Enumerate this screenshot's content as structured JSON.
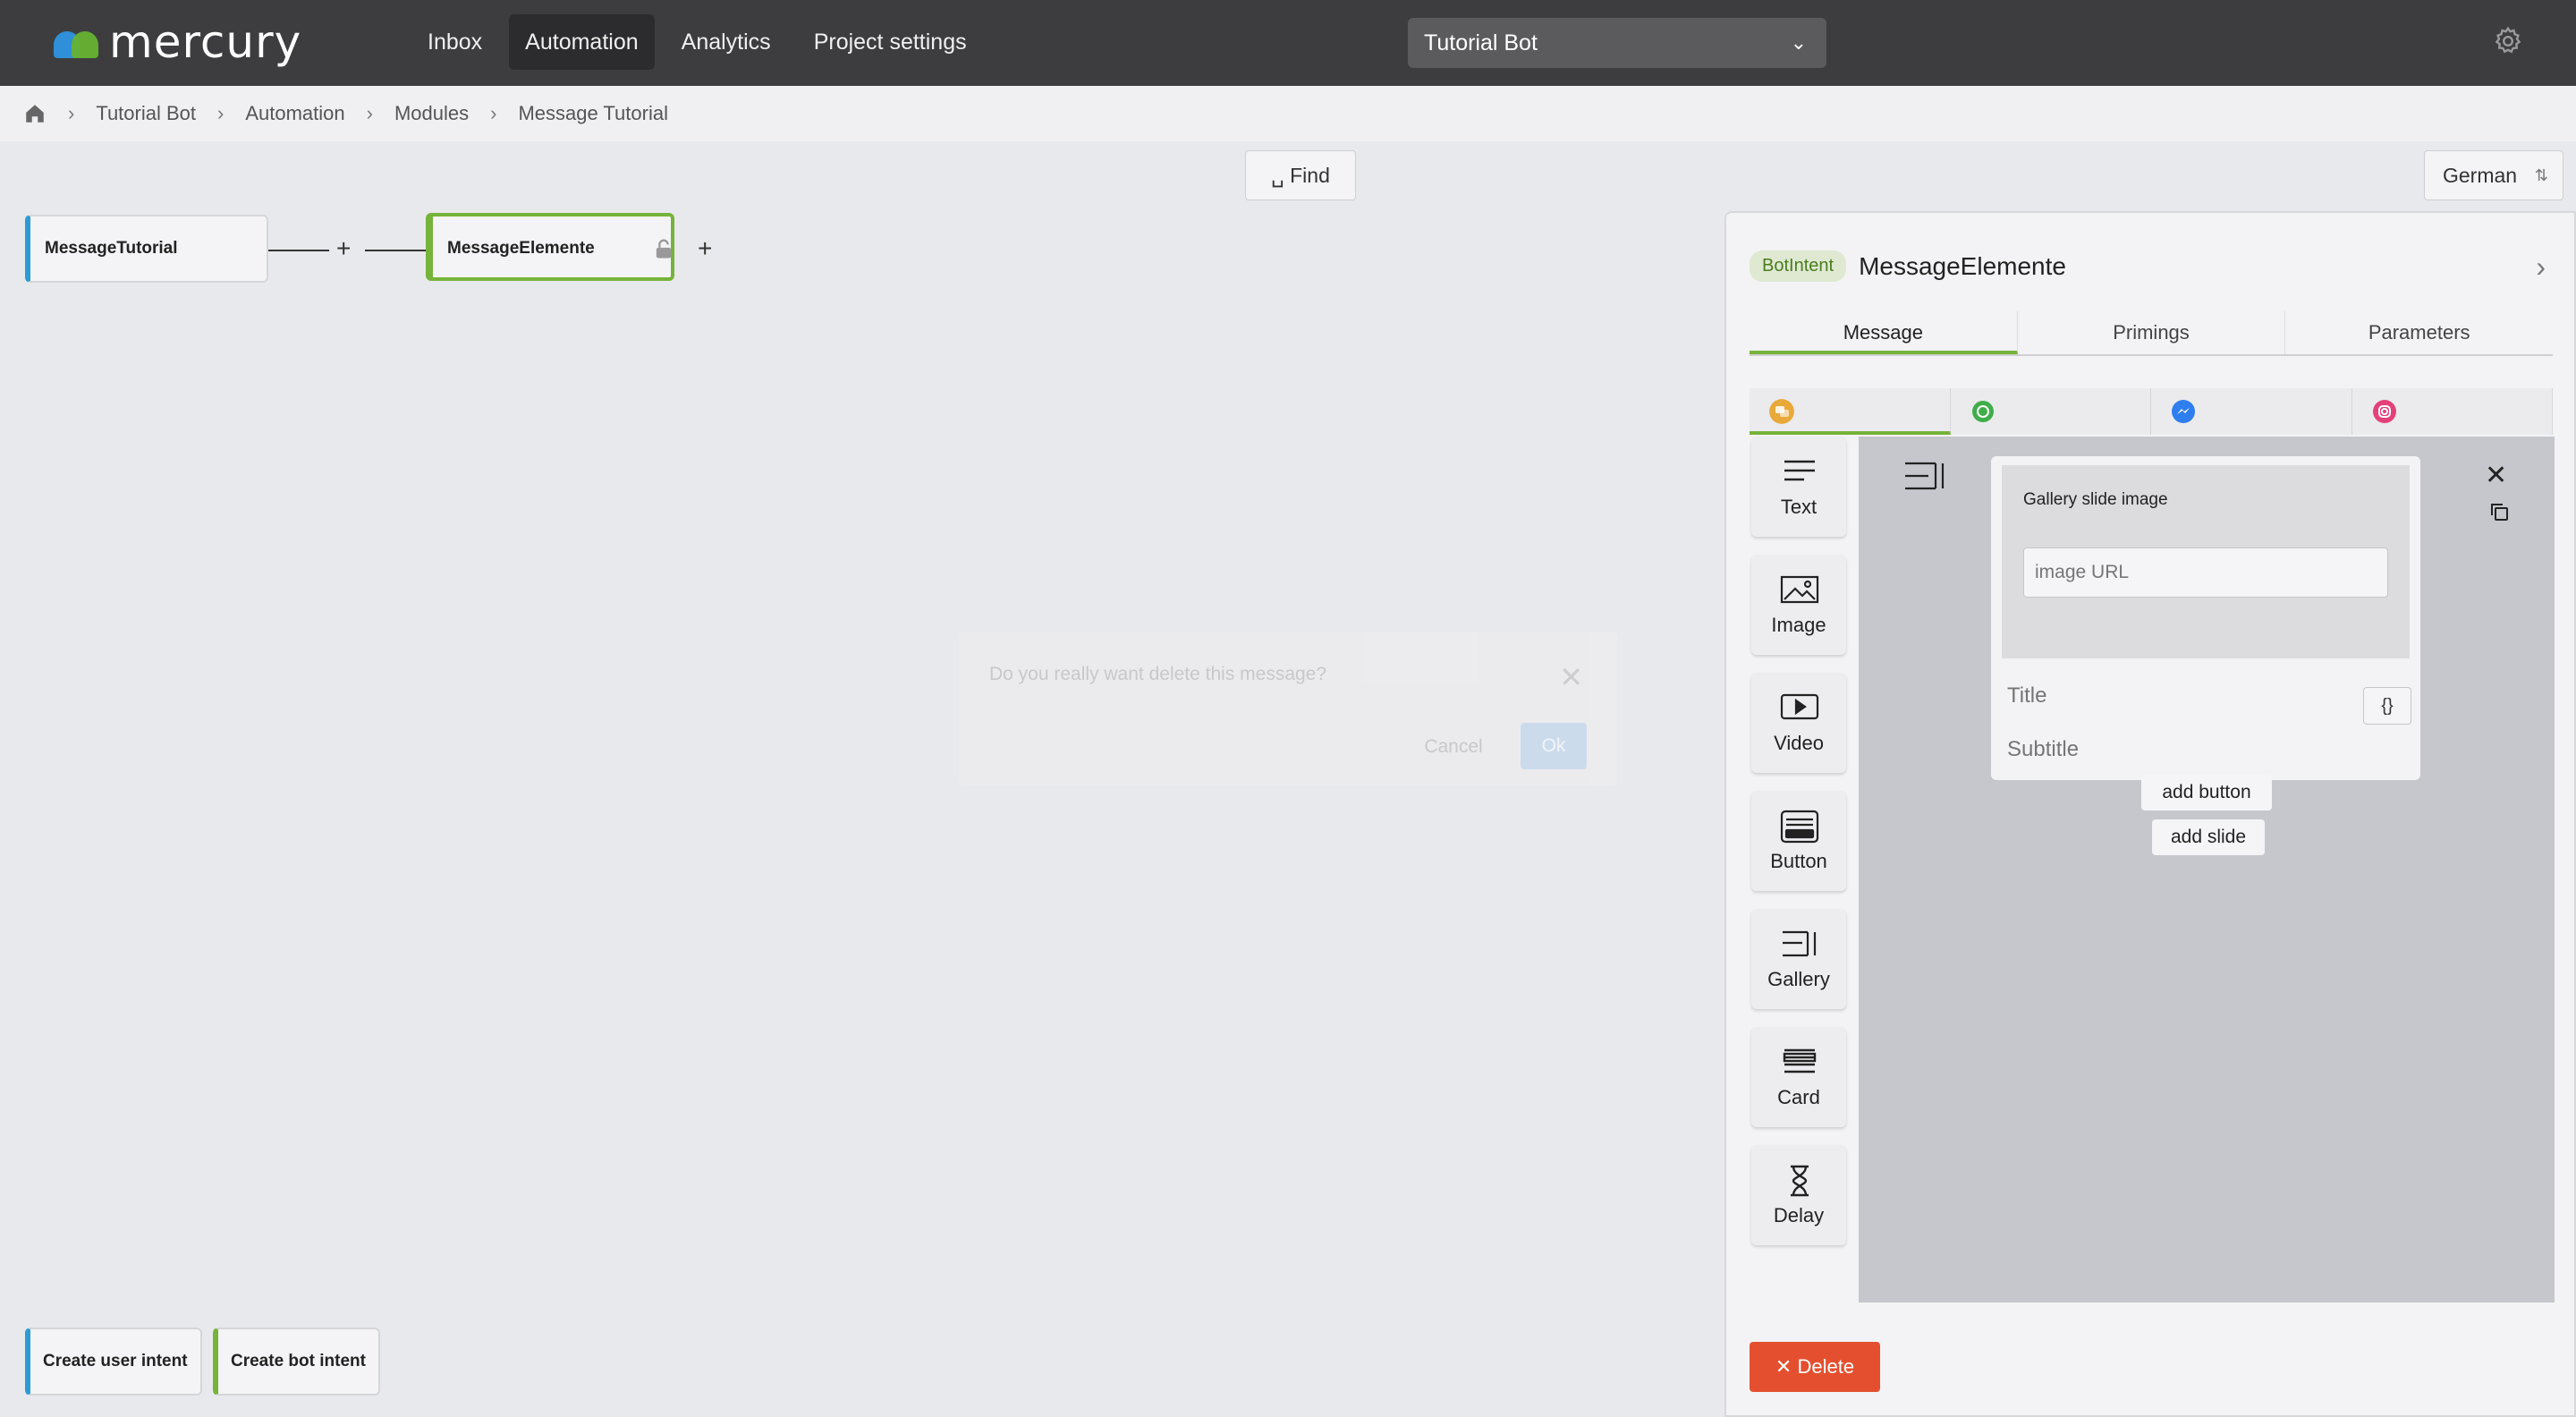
{
  "app": {
    "brand": "mercury"
  },
  "nav": {
    "items": [
      "Inbox",
      "Automation",
      "Analytics",
      "Project settings"
    ],
    "active": "Automation"
  },
  "bot_selector": {
    "value": "Tutorial Bot"
  },
  "breadcrumb": [
    "Tutorial Bot",
    "Automation",
    "Modules",
    "Message Tutorial"
  ],
  "toolbar": {
    "find_label": "Find",
    "language": "German"
  },
  "flow": {
    "nodes": [
      "MessageTutorial",
      "MessageElemente"
    ]
  },
  "modal": {
    "message": "Do you really want delete this message?",
    "cancel": "Cancel",
    "ok": "Ok"
  },
  "bottom": {
    "create_user_intent": "Create user intent",
    "create_bot_intent": "Create bot intent"
  },
  "panel": {
    "tag": "BotIntent",
    "intent_name": "MessageElemente",
    "tabs": [
      "Message",
      "Primings",
      "Parameters"
    ],
    "channels": [
      "chat-icon",
      "whatsapp-icon",
      "messenger-icon",
      "instagram-icon"
    ],
    "tools": [
      "Text",
      "Image",
      "Video",
      "Button",
      "Gallery",
      "Card",
      "Delay"
    ],
    "gallery": {
      "slide_image_label": "Gallery slide image",
      "image_url_placeholder": "image URL",
      "title_placeholder": "Title",
      "subtitle_placeholder": "Subtitle",
      "var_button": "{}",
      "add_button": "add button",
      "add_slide": "add slide"
    },
    "delete_label": "Delete"
  },
  "colors": {
    "accent_green": "#76b33a",
    "accent_blue": "#2d9bd3",
    "danger": "#e4502f",
    "topbar": "#3d3d3f"
  }
}
